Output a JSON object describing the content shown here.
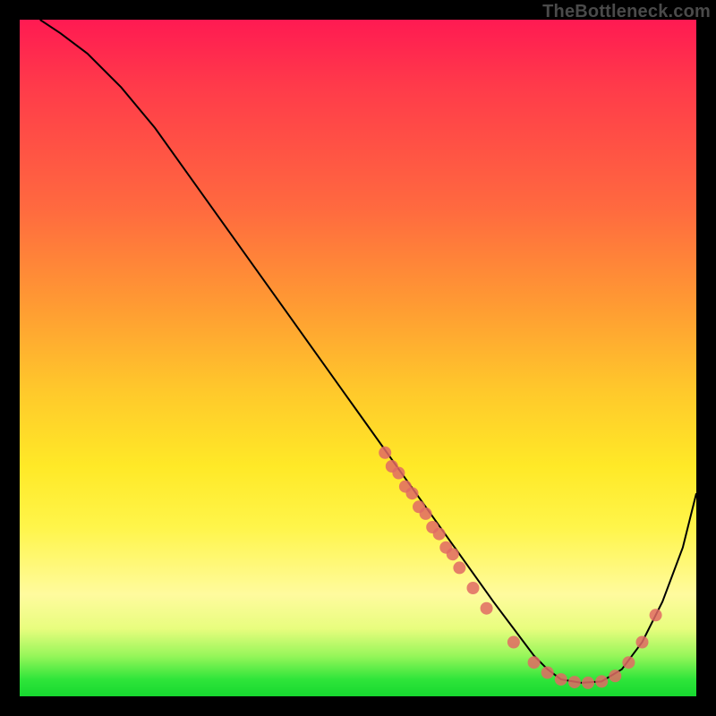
{
  "watermark": "TheBottleneck.com",
  "chart_data": {
    "type": "line",
    "title": "",
    "xlabel": "",
    "ylabel": "",
    "xlim": [
      0,
      100
    ],
    "ylim": [
      0,
      100
    ],
    "grid": false,
    "legend": false,
    "series": [
      {
        "name": "curve",
        "x": [
          3,
          6,
          10,
          15,
          20,
          25,
          30,
          35,
          40,
          45,
          50,
          55,
          60,
          65,
          70,
          73,
          76,
          78,
          80,
          83,
          86,
          89,
          92,
          95,
          98,
          100
        ],
        "y": [
          100,
          98,
          95,
          90,
          84,
          77,
          70,
          63,
          56,
          49,
          42,
          35,
          28,
          21,
          14,
          10,
          6,
          4,
          2.5,
          2,
          2.2,
          4,
          8,
          14,
          22,
          30
        ],
        "stroke": "#000000",
        "stroke_width": 2
      }
    ],
    "scatter": {
      "name": "markers",
      "color": "#e06a64",
      "radius": 7,
      "points": [
        {
          "x": 54,
          "y": 36
        },
        {
          "x": 55,
          "y": 34
        },
        {
          "x": 56,
          "y": 33
        },
        {
          "x": 57,
          "y": 31
        },
        {
          "x": 58,
          "y": 30
        },
        {
          "x": 59,
          "y": 28
        },
        {
          "x": 60,
          "y": 27
        },
        {
          "x": 61,
          "y": 25
        },
        {
          "x": 62,
          "y": 24
        },
        {
          "x": 63,
          "y": 22
        },
        {
          "x": 64,
          "y": 21
        },
        {
          "x": 65,
          "y": 19
        },
        {
          "x": 67,
          "y": 16
        },
        {
          "x": 69,
          "y": 13
        },
        {
          "x": 73,
          "y": 8
        },
        {
          "x": 76,
          "y": 5
        },
        {
          "x": 78,
          "y": 3.5
        },
        {
          "x": 80,
          "y": 2.5
        },
        {
          "x": 82,
          "y": 2.1
        },
        {
          "x": 84,
          "y": 2
        },
        {
          "x": 86,
          "y": 2.2
        },
        {
          "x": 88,
          "y": 3
        },
        {
          "x": 90,
          "y": 5
        },
        {
          "x": 92,
          "y": 8
        },
        {
          "x": 94,
          "y": 12
        }
      ]
    }
  }
}
